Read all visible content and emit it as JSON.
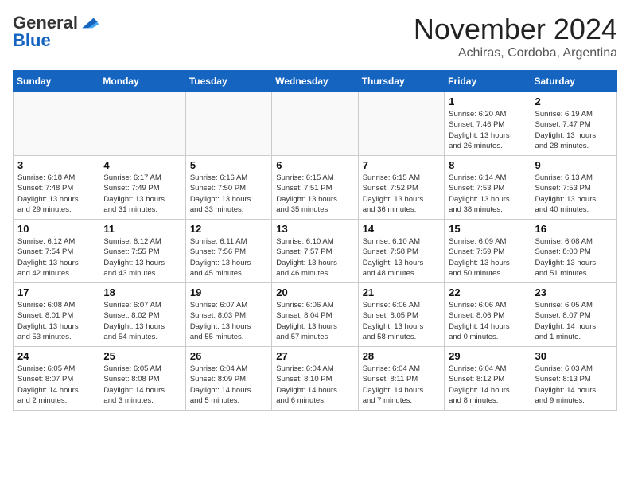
{
  "header": {
    "logo_general": "General",
    "logo_blue": "Blue",
    "month_title": "November 2024",
    "location": "Achiras, Cordoba, Argentina"
  },
  "weekdays": [
    "Sunday",
    "Monday",
    "Tuesday",
    "Wednesday",
    "Thursday",
    "Friday",
    "Saturday"
  ],
  "weeks": [
    [
      {
        "day": "",
        "info": ""
      },
      {
        "day": "",
        "info": ""
      },
      {
        "day": "",
        "info": ""
      },
      {
        "day": "",
        "info": ""
      },
      {
        "day": "",
        "info": ""
      },
      {
        "day": "1",
        "info": "Sunrise: 6:20 AM\nSunset: 7:46 PM\nDaylight: 13 hours\nand 26 minutes."
      },
      {
        "day": "2",
        "info": "Sunrise: 6:19 AM\nSunset: 7:47 PM\nDaylight: 13 hours\nand 28 minutes."
      }
    ],
    [
      {
        "day": "3",
        "info": "Sunrise: 6:18 AM\nSunset: 7:48 PM\nDaylight: 13 hours\nand 29 minutes."
      },
      {
        "day": "4",
        "info": "Sunrise: 6:17 AM\nSunset: 7:49 PM\nDaylight: 13 hours\nand 31 minutes."
      },
      {
        "day": "5",
        "info": "Sunrise: 6:16 AM\nSunset: 7:50 PM\nDaylight: 13 hours\nand 33 minutes."
      },
      {
        "day": "6",
        "info": "Sunrise: 6:15 AM\nSunset: 7:51 PM\nDaylight: 13 hours\nand 35 minutes."
      },
      {
        "day": "7",
        "info": "Sunrise: 6:15 AM\nSunset: 7:52 PM\nDaylight: 13 hours\nand 36 minutes."
      },
      {
        "day": "8",
        "info": "Sunrise: 6:14 AM\nSunset: 7:53 PM\nDaylight: 13 hours\nand 38 minutes."
      },
      {
        "day": "9",
        "info": "Sunrise: 6:13 AM\nSunset: 7:53 PM\nDaylight: 13 hours\nand 40 minutes."
      }
    ],
    [
      {
        "day": "10",
        "info": "Sunrise: 6:12 AM\nSunset: 7:54 PM\nDaylight: 13 hours\nand 42 minutes."
      },
      {
        "day": "11",
        "info": "Sunrise: 6:12 AM\nSunset: 7:55 PM\nDaylight: 13 hours\nand 43 minutes."
      },
      {
        "day": "12",
        "info": "Sunrise: 6:11 AM\nSunset: 7:56 PM\nDaylight: 13 hours\nand 45 minutes."
      },
      {
        "day": "13",
        "info": "Sunrise: 6:10 AM\nSunset: 7:57 PM\nDaylight: 13 hours\nand 46 minutes."
      },
      {
        "day": "14",
        "info": "Sunrise: 6:10 AM\nSunset: 7:58 PM\nDaylight: 13 hours\nand 48 minutes."
      },
      {
        "day": "15",
        "info": "Sunrise: 6:09 AM\nSunset: 7:59 PM\nDaylight: 13 hours\nand 50 minutes."
      },
      {
        "day": "16",
        "info": "Sunrise: 6:08 AM\nSunset: 8:00 PM\nDaylight: 13 hours\nand 51 minutes."
      }
    ],
    [
      {
        "day": "17",
        "info": "Sunrise: 6:08 AM\nSunset: 8:01 PM\nDaylight: 13 hours\nand 53 minutes."
      },
      {
        "day": "18",
        "info": "Sunrise: 6:07 AM\nSunset: 8:02 PM\nDaylight: 13 hours\nand 54 minutes."
      },
      {
        "day": "19",
        "info": "Sunrise: 6:07 AM\nSunset: 8:03 PM\nDaylight: 13 hours\nand 55 minutes."
      },
      {
        "day": "20",
        "info": "Sunrise: 6:06 AM\nSunset: 8:04 PM\nDaylight: 13 hours\nand 57 minutes."
      },
      {
        "day": "21",
        "info": "Sunrise: 6:06 AM\nSunset: 8:05 PM\nDaylight: 13 hours\nand 58 minutes."
      },
      {
        "day": "22",
        "info": "Sunrise: 6:06 AM\nSunset: 8:06 PM\nDaylight: 14 hours\nand 0 minutes."
      },
      {
        "day": "23",
        "info": "Sunrise: 6:05 AM\nSunset: 8:07 PM\nDaylight: 14 hours\nand 1 minute."
      }
    ],
    [
      {
        "day": "24",
        "info": "Sunrise: 6:05 AM\nSunset: 8:07 PM\nDaylight: 14 hours\nand 2 minutes."
      },
      {
        "day": "25",
        "info": "Sunrise: 6:05 AM\nSunset: 8:08 PM\nDaylight: 14 hours\nand 3 minutes."
      },
      {
        "day": "26",
        "info": "Sunrise: 6:04 AM\nSunset: 8:09 PM\nDaylight: 14 hours\nand 5 minutes."
      },
      {
        "day": "27",
        "info": "Sunrise: 6:04 AM\nSunset: 8:10 PM\nDaylight: 14 hours\nand 6 minutes."
      },
      {
        "day": "28",
        "info": "Sunrise: 6:04 AM\nSunset: 8:11 PM\nDaylight: 14 hours\nand 7 minutes."
      },
      {
        "day": "29",
        "info": "Sunrise: 6:04 AM\nSunset: 8:12 PM\nDaylight: 14 hours\nand 8 minutes."
      },
      {
        "day": "30",
        "info": "Sunrise: 6:03 AM\nSunset: 8:13 PM\nDaylight: 14 hours\nand 9 minutes."
      }
    ]
  ]
}
